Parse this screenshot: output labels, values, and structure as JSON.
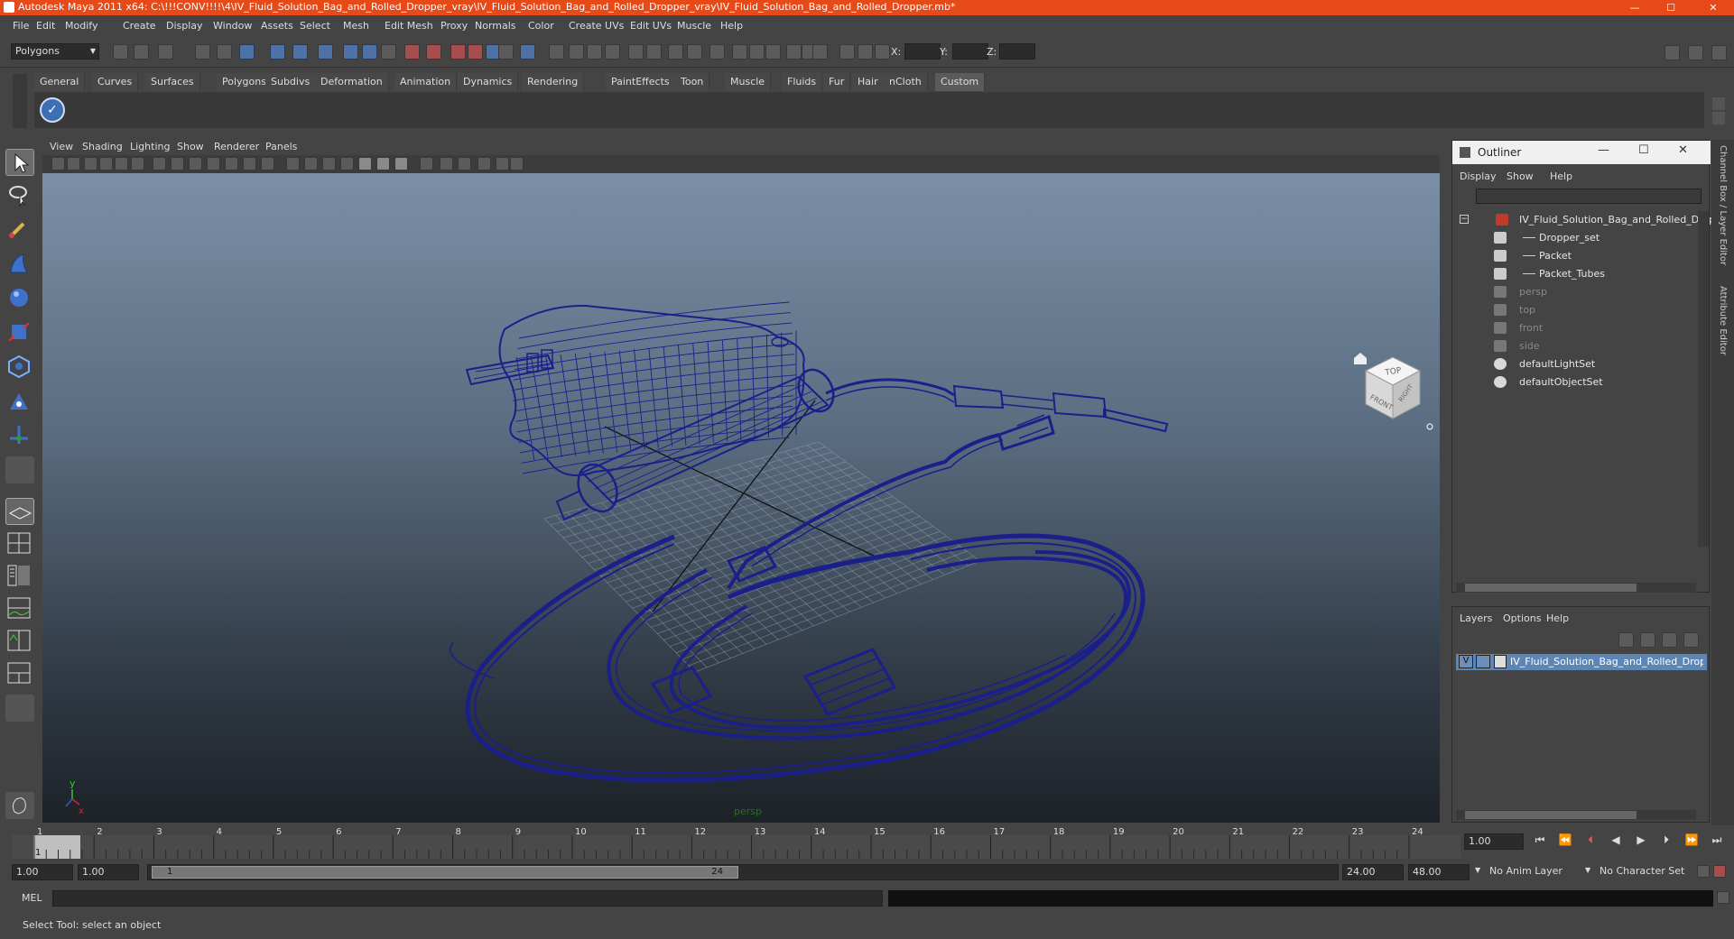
{
  "window": {
    "title": "Autodesk Maya 2011 x64: C:\\!!!CONV!!!!\\4\\IV_Fluid_Solution_Bag_and_Rolled_Dropper_vray\\IV_Fluid_Solution_Bag_and_Rolled_Dropper_vray\\IV_Fluid_Solution_Bag_and_Rolled_Dropper.mb*"
  },
  "menubar": {
    "items": [
      "File",
      "Edit",
      "Modify",
      "Create",
      "Display",
      "Window",
      "Assets",
      "Select",
      "Mesh",
      "Edit Mesh",
      "Proxy",
      "Normals",
      "Color",
      "Create UVs",
      "Edit UVs",
      "Muscle",
      "Help"
    ]
  },
  "statusline": {
    "mode": "Polygons",
    "x_label": "X:",
    "y_label": "Y:",
    "z_label": "Z:"
  },
  "shelf": {
    "tabs": [
      "General",
      "Curves",
      "Surfaces",
      "Polygons",
      "Subdivs",
      "Deformation",
      "Animation",
      "Dynamics",
      "Rendering",
      "PaintEffects",
      "Toon",
      "Muscle",
      "Fluids",
      "Fur",
      "Hair",
      "nCloth",
      "Custom"
    ],
    "active": "Custom"
  },
  "panel": {
    "menu": [
      "View",
      "Shading",
      "Lighting",
      "Show",
      "Renderer",
      "Panels"
    ],
    "camera_label": "persp",
    "viewcube_top": "TOP",
    "viewcube_front": "FRONT",
    "viewcube_right": "RIGHT",
    "axis_y": "y",
    "axis_x": "x"
  },
  "outliner": {
    "title": "Outliner",
    "menu": [
      "Display",
      "Show",
      "Help"
    ],
    "rows": [
      {
        "label": "IV_Fluid_Solution_Bag_and_Rolled_Drop",
        "dim": false,
        "indent": 0
      },
      {
        "label": "Dropper_set",
        "dim": false,
        "indent": 1
      },
      {
        "label": "Packet",
        "dim": false,
        "indent": 1
      },
      {
        "label": "Packet_Tubes",
        "dim": false,
        "indent": 1
      },
      {
        "label": "persp",
        "dim": true,
        "indent": 0
      },
      {
        "label": "top",
        "dim": true,
        "indent": 0
      },
      {
        "label": "front",
        "dim": true,
        "indent": 0
      },
      {
        "label": "side",
        "dim": true,
        "indent": 0
      },
      {
        "label": "defaultLightSet",
        "dim": false,
        "indent": 0
      },
      {
        "label": "defaultObjectSet",
        "dim": false,
        "indent": 0
      }
    ]
  },
  "layers": {
    "menu": [
      "Layers",
      "Options",
      "Help"
    ],
    "layer_visibility": "V",
    "layer_name": "IV_Fluid_Solution_Bag_and_Rolled_Dropper"
  },
  "side_tabs": {
    "channel_box": "Channel Box / Layer Editor",
    "attribute_editor": "Attribute Editor"
  },
  "timeslider": {
    "ticks": [
      "1",
      "2",
      "3",
      "4",
      "5",
      "6",
      "7",
      "8",
      "9",
      "10",
      "11",
      "12",
      "13",
      "14",
      "15",
      "16",
      "17",
      "18",
      "19",
      "20",
      "21",
      "22",
      "23",
      "24"
    ],
    "current_marker": "1",
    "current_time": "1.00"
  },
  "rangeslider": {
    "start": "1.00",
    "playback_start": "1.00",
    "range_start_label": "1",
    "range_end_label": "24",
    "playback_end": "24.00",
    "end": "48.00",
    "anim_layer": "No Anim Layer",
    "character_set": "No Character Set"
  },
  "cmdline": {
    "label": "MEL"
  },
  "helpline": {
    "text": "Select Tool: select an object"
  },
  "colors": {
    "title_bar": "#e64a19",
    "wire": "#1a1f8a",
    "selected_layer": "#5d86b5"
  }
}
